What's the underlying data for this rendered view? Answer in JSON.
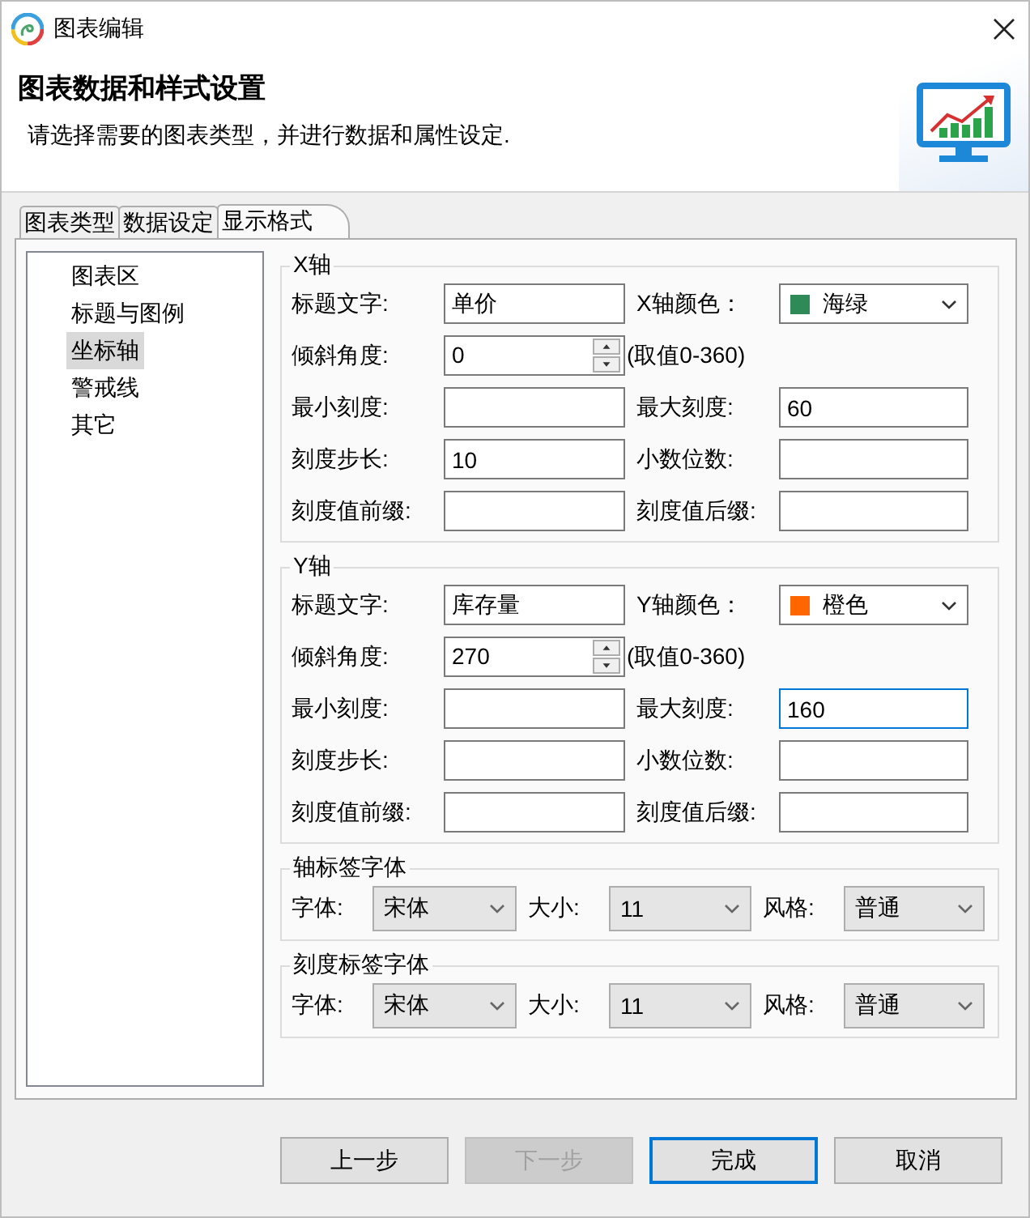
{
  "window": {
    "title": "图表编辑"
  },
  "header": {
    "title": "图表数据和样式设置",
    "description": "请选择需要的图表类型，并进行数据和属性设定."
  },
  "tabs": [
    {
      "label": "图表类型",
      "selected": false
    },
    {
      "label": "数据设定",
      "selected": false
    },
    {
      "label": "显示格式",
      "selected": true
    }
  ],
  "sidebar": {
    "items": [
      {
        "label": "图表区",
        "selected": false
      },
      {
        "label": "标题与图例",
        "selected": false
      },
      {
        "label": "坐标轴",
        "selected": true
      },
      {
        "label": "警戒线",
        "selected": false
      },
      {
        "label": "其它",
        "selected": false
      }
    ]
  },
  "axes": [
    {
      "title": "X轴",
      "fields": [
        {
          "label": "标题文字:",
          "kind": "text",
          "value": "单价",
          "focused": false
        },
        {
          "label": "X轴颜色：",
          "kind": "color",
          "value": "海绿",
          "color": "#2e8b57"
        },
        {
          "label": "倾斜角度:",
          "kind": "spinner",
          "value": "0",
          "focused": false
        },
        {
          "kind": "note",
          "text": "(取值0-360)"
        },
        {
          "label": "最小刻度:",
          "kind": "text",
          "focused": false
        },
        {
          "label": "最大刻度:",
          "kind": "text",
          "value": "60",
          "focused": false
        },
        {
          "label": "刻度步长:",
          "kind": "text",
          "value": "10",
          "focused": false
        },
        {
          "label": "小数位数:",
          "kind": "text",
          "focused": false
        },
        {
          "label": "刻度值前缀:",
          "kind": "text",
          "focused": false
        },
        {
          "label": "刻度值后缀:",
          "kind": "text",
          "focused": false
        }
      ]
    },
    {
      "title": "Y轴",
      "fields": [
        {
          "label": "标题文字:",
          "kind": "text",
          "value": "库存量",
          "focused": false
        },
        {
          "label": "Y轴颜色：",
          "kind": "color",
          "value": "橙色",
          "color": "#ff6600"
        },
        {
          "label": "倾斜角度:",
          "kind": "spinner",
          "value": "270",
          "focused": false
        },
        {
          "kind": "note",
          "text": "(取值0-360)"
        },
        {
          "label": "最小刻度:",
          "kind": "text",
          "focused": false
        },
        {
          "label": "最大刻度:",
          "kind": "text",
          "value": "160",
          "focused": true
        },
        {
          "label": "刻度步长:",
          "kind": "text",
          "focused": false
        },
        {
          "label": "小数位数:",
          "kind": "text",
          "focused": false
        },
        {
          "label": "刻度值前缀:",
          "kind": "text",
          "focused": false
        },
        {
          "label": "刻度值后缀:",
          "kind": "text",
          "focused": false
        }
      ]
    }
  ],
  "fonts": [
    {
      "title": "轴标签字体",
      "fields": [
        {
          "label": "字体:",
          "value": "宋体"
        },
        {
          "label": "大小:",
          "value": "11"
        },
        {
          "label": "风格:",
          "value": "普通"
        }
      ]
    },
    {
      "title": "刻度标签字体",
      "fields": [
        {
          "label": "字体:",
          "value": "宋体"
        },
        {
          "label": "大小:",
          "value": "11"
        },
        {
          "label": "风格:",
          "value": "普通"
        }
      ]
    }
  ],
  "buttons": [
    {
      "label": "上一步",
      "disabled": false,
      "default": false
    },
    {
      "label": "下一步",
      "disabled": true,
      "default": false
    },
    {
      "label": "完成",
      "disabled": false,
      "default": true
    },
    {
      "label": "取消",
      "disabled": false,
      "default": false
    }
  ]
}
